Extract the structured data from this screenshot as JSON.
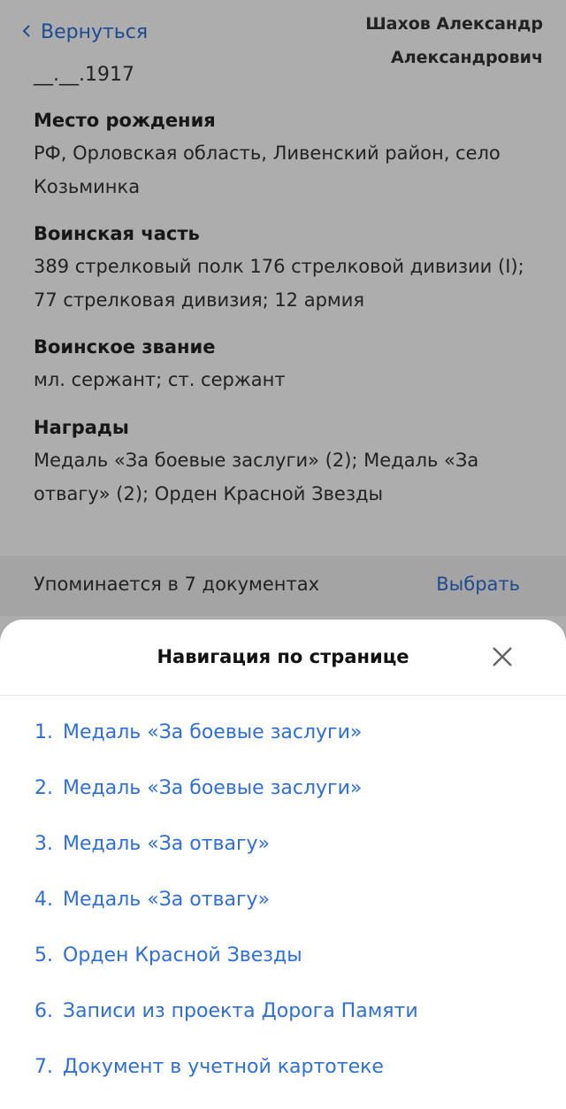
{
  "header": {
    "back_label": "Вернуться",
    "person_name": "Шахов Александр Александрович"
  },
  "profile": {
    "birth_date": "__.__.1917",
    "fields": [
      {
        "label": "Место рождения",
        "value": "РФ, Орловская область, Ливенский район, село Козьминка"
      },
      {
        "label": "Воинская часть",
        "value": "389 стрелковый полк 176 стрелковой дивизии (I); 77 стрелковая дивизия; 12 армия"
      },
      {
        "label": "Воинское звание",
        "value": "мл. сержант; ст. сержант"
      },
      {
        "label": "Награды",
        "value": "Медаль «За боевые заслуги» (2); Медаль «За отвагу» (2); Орден Красной Звезды"
      }
    ]
  },
  "documents": {
    "mentions_text": "Упоминается в 7 документах",
    "choose_label": "Выбрать"
  },
  "sheet": {
    "title": "Навигация по странице",
    "items": [
      {
        "num": "1.",
        "label": "Медаль «За боевые заслуги»"
      },
      {
        "num": "2.",
        "label": "Медаль «За боевые заслуги»"
      },
      {
        "num": "3.",
        "label": "Медаль «За отвагу»"
      },
      {
        "num": "4.",
        "label": "Медаль «За отвагу»"
      },
      {
        "num": "5.",
        "label": "Орден Красной Звезды"
      },
      {
        "num": "6.",
        "label": "Записи из проекта Дорога Памяти"
      },
      {
        "num": "7.",
        "label": "Документ в учетной картотеке"
      }
    ]
  }
}
